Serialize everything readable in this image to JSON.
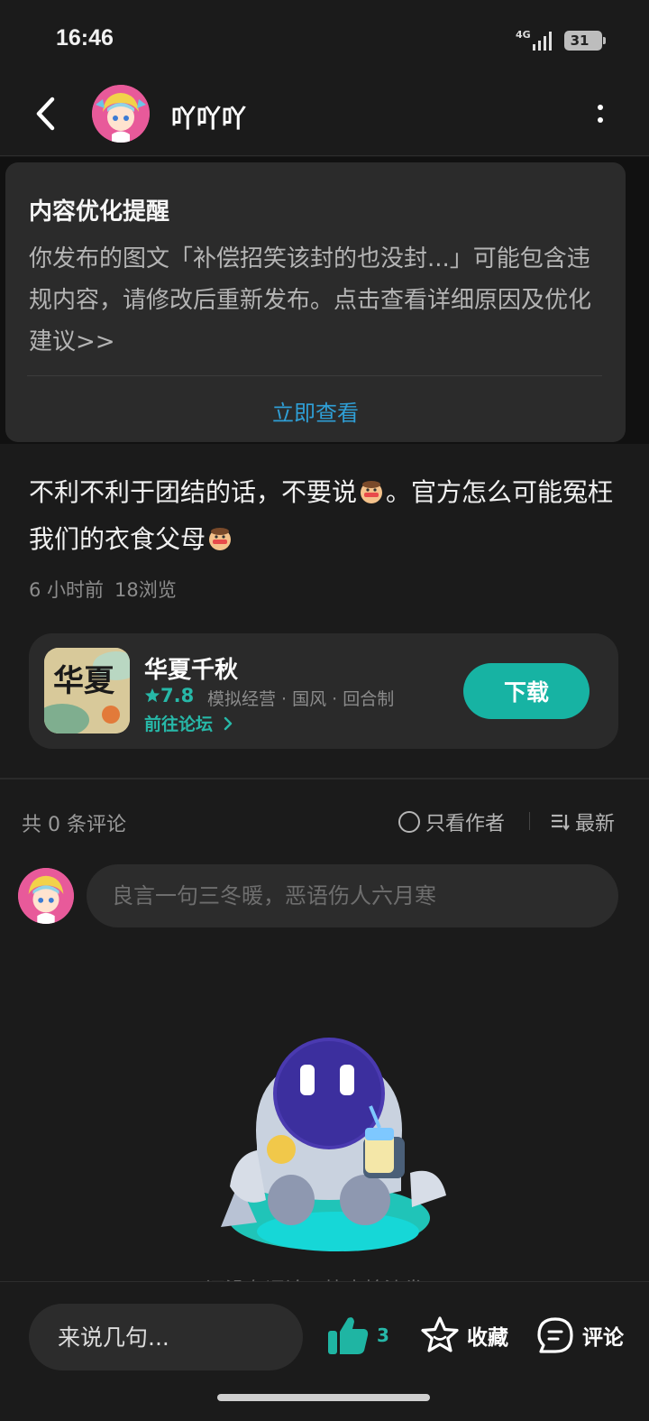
{
  "status_bar": {
    "time": "16:46",
    "network": "4G",
    "battery": "31"
  },
  "header": {
    "username": "吖吖吖"
  },
  "notice": {
    "title": "内容优化提醒",
    "body": "你发布的图文「补偿招笑该封的也没封...」可能包含违规内容，请修改后重新发布。点击查看详细原因及优化建议>>",
    "action": "立即查看"
  },
  "post": {
    "text_part1": "不利不利于团结的话，不要说",
    "text_part2": "。官方怎么可能冤枉我们的衣食父母",
    "time_ago": "6 小时前",
    "views": "18浏览"
  },
  "game": {
    "name": "华夏千秋",
    "rating": "7.8",
    "tags": "模拟经营 · 国风 · 回合制",
    "forum_link": "前往论坛",
    "download": "下载",
    "icon_text": "华夏"
  },
  "comments": {
    "count_label": "共 0 条评论",
    "author_only": "只看作者",
    "sort": "最新",
    "placeholder": "良言一句三冬暖，恶语伤人六月寒",
    "empty_text": "还没有评论，快来抢沙发！"
  },
  "bottom_bar": {
    "reply_placeholder": "来说几句...",
    "like_count": "3",
    "favorite": "收藏",
    "comment": "评论"
  },
  "colors": {
    "accent": "#17b3a3",
    "link": "#2f9fd6",
    "background": "#1b1b1b",
    "card": "#2b2b2b"
  },
  "icons": [
    "back-arrow-icon",
    "more-icon",
    "star-icon",
    "chevron-right-icon",
    "radio-icon",
    "sort-icon",
    "thumbs-up-icon",
    "star-outline-icon",
    "comment-icon"
  ]
}
